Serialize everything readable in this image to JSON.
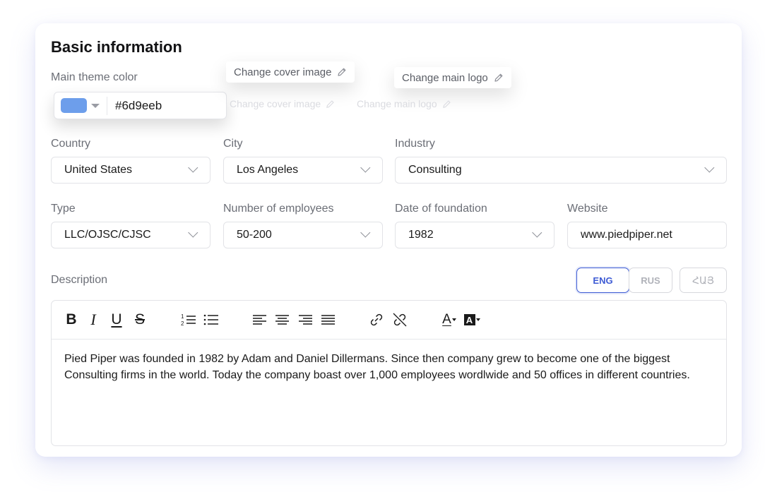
{
  "form": {
    "title": "Basic information",
    "theme_color_label": "Main theme color",
    "theme_color_value": "#6d9eeb",
    "change_cover_label": "Change cover image",
    "change_logo_label": "Change main logo",
    "change_cover_ghost": "Change cover image",
    "change_logo_ghost": "Change main logo"
  },
  "fields": {
    "country": {
      "label": "Country",
      "value": "United States"
    },
    "city": {
      "label": "City",
      "value": "Los Angeles"
    },
    "industry": {
      "label": "Industry",
      "value": "Consulting"
    },
    "type": {
      "label": "Type",
      "value": "LLC/OJSC/CJSC"
    },
    "employees": {
      "label": "Number of employees",
      "value": "50-200"
    },
    "foundation": {
      "label": "Date of foundation",
      "value": "1982"
    },
    "website": {
      "label": "Website",
      "value": "www.piedpiper.net"
    }
  },
  "description": {
    "label": "Description",
    "languages": [
      "ENG",
      "RUS",
      "ՀԱՅ"
    ],
    "active_language": "ENG",
    "text": "Pied Piper was founded in 1982 by Adam and Daniel Dillermans. Since then company grew to become one of the biggest Consulting firms in the world. Today the company boast over 1,000 employees wordlwide and 50 offices in different countries."
  },
  "toolbar": {
    "bold": "B",
    "italic": "I",
    "underline": "U",
    "strike": "S",
    "text_color_glyph": "A",
    "highlight_glyph": "A",
    "icons": [
      "bold-icon",
      "italic-icon",
      "underline-icon",
      "strikethrough-icon",
      "ordered-list-icon",
      "bullet-list-icon",
      "align-left-icon",
      "align-center-icon",
      "align-right-icon",
      "align-justify-icon",
      "link-icon",
      "unlink-icon",
      "text-color-icon",
      "highlight-color-icon"
    ]
  },
  "colors": {
    "accent": "#3d5bd4",
    "theme_swatch": "#6d9eeb"
  }
}
